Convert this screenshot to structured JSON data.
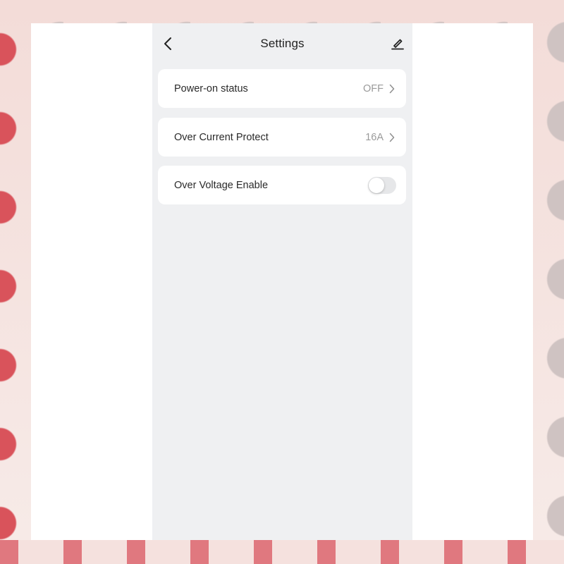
{
  "header": {
    "title": "Settings",
    "back_icon": "chevron-left-icon",
    "edit_icon": "pencil-icon"
  },
  "settings": [
    {
      "label": "Power-on status",
      "value": "OFF",
      "control": "chevron"
    },
    {
      "label": "Over Current Protect",
      "value": "16A",
      "control": "chevron"
    },
    {
      "label": "Over Voltage Enable",
      "control": "toggle",
      "toggle_on": false
    }
  ],
  "colors": {
    "page_background": "#eff0f2",
    "card_background": "#ffffff",
    "value_text": "#9a9a9a",
    "label_text": "#2a2a2a"
  }
}
